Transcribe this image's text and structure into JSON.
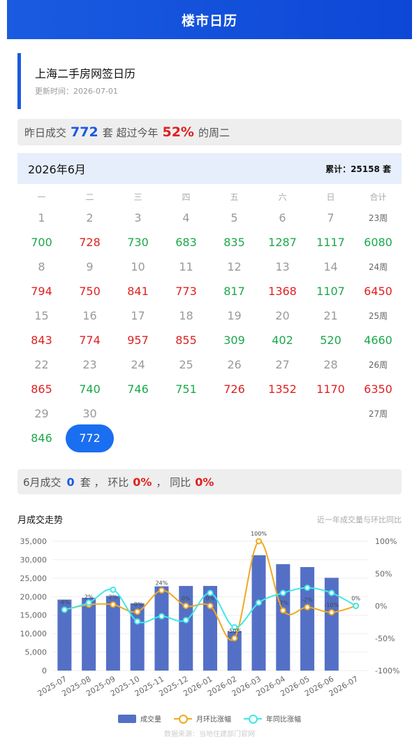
{
  "header": {
    "title": "楼市日历"
  },
  "info": {
    "title": "上海二手房网签日历",
    "updated": "更新时间：2026-07-01"
  },
  "summary": {
    "prefix": "昨日成交",
    "count": "772",
    "unit": "套 超过今年",
    "percent": "52%",
    "suffix": "的周二"
  },
  "month": {
    "label": "2026年6月",
    "total": "累计：25158 套"
  },
  "weekdays": [
    "一",
    "二",
    "三",
    "四",
    "五",
    "六",
    "日",
    "合计"
  ],
  "weeks": [
    {
      "days": [
        "1",
        "2",
        "3",
        "4",
        "5",
        "6",
        "7"
      ],
      "week": "23周",
      "values": [
        {
          "v": "700",
          "c": "g"
        },
        {
          "v": "728",
          "c": "r"
        },
        {
          "v": "730",
          "c": "g"
        },
        {
          "v": "683",
          "c": "g"
        },
        {
          "v": "835",
          "c": "g"
        },
        {
          "v": "1287",
          "c": "g"
        },
        {
          "v": "1117",
          "c": "g"
        },
        {
          "v": "6080",
          "c": "g"
        }
      ]
    },
    {
      "days": [
        "8",
        "9",
        "10",
        "11",
        "12",
        "13",
        "14"
      ],
      "week": "24周",
      "values": [
        {
          "v": "794",
          "c": "r"
        },
        {
          "v": "750",
          "c": "r"
        },
        {
          "v": "841",
          "c": "r"
        },
        {
          "v": "773",
          "c": "r"
        },
        {
          "v": "817",
          "c": "g"
        },
        {
          "v": "1368",
          "c": "r"
        },
        {
          "v": "1107",
          "c": "g"
        },
        {
          "v": "6450",
          "c": "r"
        }
      ]
    },
    {
      "days": [
        "15",
        "16",
        "17",
        "18",
        "19",
        "20",
        "21"
      ],
      "week": "25周",
      "values": [
        {
          "v": "843",
          "c": "r"
        },
        {
          "v": "774",
          "c": "r"
        },
        {
          "v": "957",
          "c": "r"
        },
        {
          "v": "855",
          "c": "r"
        },
        {
          "v": "309",
          "c": "g"
        },
        {
          "v": "402",
          "c": "g"
        },
        {
          "v": "520",
          "c": "g"
        },
        {
          "v": "4660",
          "c": "g"
        }
      ]
    },
    {
      "days": [
        "22",
        "23",
        "24",
        "25",
        "26",
        "27",
        "28"
      ],
      "week": "26周",
      "values": [
        {
          "v": "865",
          "c": "r"
        },
        {
          "v": "740",
          "c": "g"
        },
        {
          "v": "746",
          "c": "g"
        },
        {
          "v": "751",
          "c": "g"
        },
        {
          "v": "726",
          "c": "r"
        },
        {
          "v": "1352",
          "c": "r"
        },
        {
          "v": "1170",
          "c": "r"
        },
        {
          "v": "6350",
          "c": "r"
        }
      ]
    },
    {
      "days": [
        "29",
        "30",
        "",
        "",
        "",
        "",
        ""
      ],
      "week": "27周",
      "values": [
        {
          "v": "846",
          "c": "g"
        },
        {
          "v": "772",
          "c": "today"
        },
        {
          "v": "",
          "c": ""
        },
        {
          "v": "",
          "c": ""
        },
        {
          "v": "",
          "c": ""
        },
        {
          "v": "",
          "c": ""
        },
        {
          "v": "",
          "c": ""
        },
        {
          "v": "",
          "c": ""
        }
      ]
    }
  ],
  "monthly": {
    "prefix": "6月成交",
    "count": "0",
    "unit": "套 ， 环比",
    "mom": "0%",
    "sep": "， 同比",
    "yoy": "0%"
  },
  "chart": {
    "title": "月成交走势",
    "subtitle": "近一年成交量与环比同比"
  },
  "chart_data": {
    "type": "bar",
    "categories": [
      "2025-07",
      "2025-08",
      "2025-09",
      "2025-10",
      "2025-11",
      "2025-12",
      "2026-01",
      "2026-02",
      "2026-03",
      "2026-04",
      "2026-05",
      "2026-06",
      "2026-07"
    ],
    "series": [
      {
        "name": "成交量",
        "type": "bar",
        "values": [
          19200,
          19700,
          20200,
          18200,
          22800,
          22900,
          22900,
          10600,
          31200,
          28800,
          28000,
          25100,
          0
        ]
      },
      {
        "name": "月环比涨幅",
        "type": "line",
        "values": [
          -6,
          2,
          2,
          -9,
          24,
          0,
          0,
          -50,
          100,
          -7,
          -2,
          -10,
          0
        ],
        "labels": [
          "-6%",
          "2%",
          "2%",
          "-9%",
          "24%",
          "0%",
          "0%",
          "-50%",
          "100%",
          "-7%",
          "-2%",
          "-10%",
          "0%"
        ]
      },
      {
        "name": "年同比涨幅",
        "type": "line",
        "values": [
          -6,
          5,
          25,
          -24,
          -16,
          -22,
          20,
          -33,
          5,
          20,
          28,
          20,
          0
        ]
      }
    ],
    "y_left": {
      "min": 0,
      "max": 35000,
      "ticks": [
        "0",
        "5,000",
        "10,000",
        "15,000",
        "20,000",
        "25,000",
        "30,000",
        "35,000"
      ]
    },
    "y_right": {
      "min": -100,
      "max": 100,
      "ticks": [
        "-100%",
        "-50%",
        "0%",
        "50%",
        "100%"
      ]
    },
    "colors": {
      "bar": "#5470c6",
      "mom": "#f0a91f",
      "yoy": "#3ee8e8"
    },
    "legend": "bottom-center"
  },
  "source": "数据来源：当地住建部门官网"
}
